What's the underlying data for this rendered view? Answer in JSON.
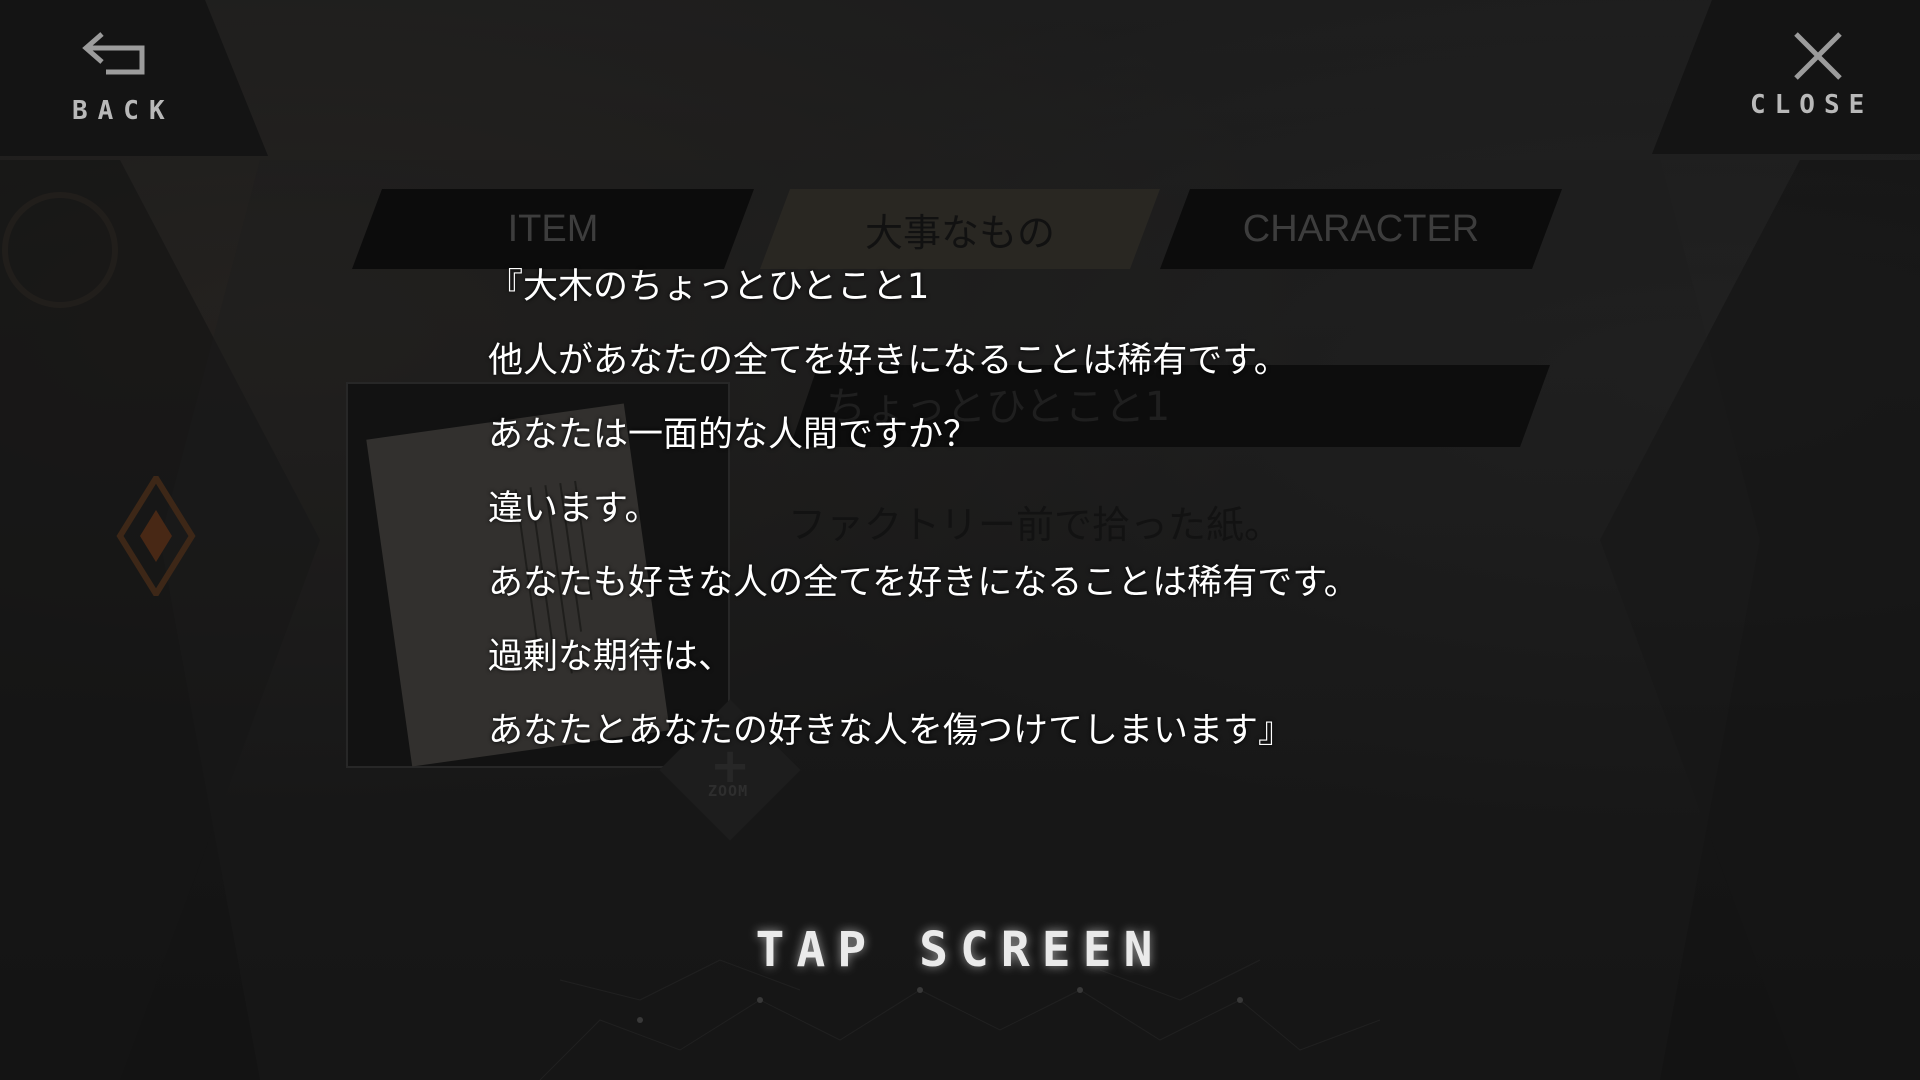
{
  "nav": {
    "back_label": "BACK",
    "close_label": "CLOSE"
  },
  "tabs": [
    {
      "label": "ITEM",
      "active": false
    },
    {
      "label": "大事なもの",
      "active": true
    },
    {
      "label": "CHARACTER",
      "active": false
    }
  ],
  "detail": {
    "item_name": "ちょっとひとこと1",
    "description": "ファクトリー前で拾った紙。",
    "zoom_label": "ZOOM"
  },
  "reading": {
    "lines": [
      "『大木のちょっとひとこと1",
      "他人があなたの全てを好きになることは稀有です。",
      "あなたは一面的な人間ですか？",
      "違います。",
      "あなたも好きな人の全てを好きになることは稀有です。",
      "過剰な期待は、",
      "あなたとあなたの好きな人を傷つけてしまいます』"
    ]
  },
  "prompt": "TAP SCREEN",
  "colors": {
    "accent": "#b0501e",
    "text": "#ffffff",
    "panel": "#141414"
  }
}
